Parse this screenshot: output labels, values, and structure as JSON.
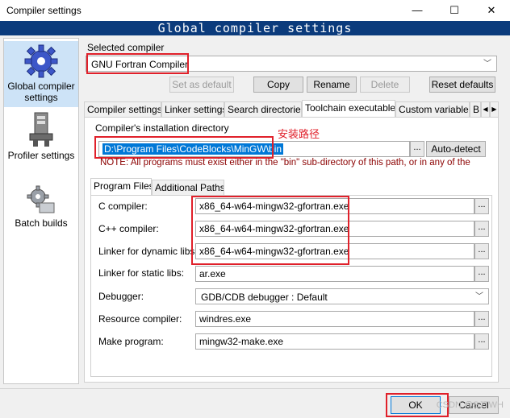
{
  "window": {
    "title": "Compiler settings",
    "min": "—",
    "max": "☐",
    "close": "✕"
  },
  "banner": "Global compiler settings",
  "sidebar": {
    "items": [
      {
        "label": "Global compiler settings",
        "icon": "gear-icon"
      },
      {
        "label": "Profiler settings",
        "icon": "profiler-icon"
      },
      {
        "label": "Batch builds",
        "icon": "batch-builds-icon"
      }
    ]
  },
  "compiler": {
    "section_label": "Selected compiler",
    "selected": "GNU Fortran Compiler",
    "buttons": {
      "set_default": "Set as default",
      "copy": "Copy",
      "rename": "Rename",
      "delete": "Delete",
      "reset": "Reset defaults"
    }
  },
  "tabs": [
    "Compiler settings",
    "Linker settings",
    "Search directories",
    "Toolchain executables",
    "Custom variables",
    "B"
  ],
  "tab_scroll": {
    "left": "◀",
    "right": "▶"
  },
  "install_dir": {
    "label": "Compiler's installation directory",
    "value": "D:\\Program Files\\CodeBlocks\\MinGW\\bin",
    "browse": "...",
    "auto_detect": "Auto-detect",
    "annotation": "安装路径",
    "note": "NOTE: All programs must exist either in the \"bin\" sub-directory of this path, or in any of the"
  },
  "subtabs": [
    "Program Files",
    "Additional Paths"
  ],
  "programs": [
    {
      "label": "C compiler:",
      "value": "x86_64-w64-mingw32-gfortran.exe"
    },
    {
      "label": "C++ compiler:",
      "value": "x86_64-w64-mingw32-gfortran.exe"
    },
    {
      "label": "Linker for dynamic libs:",
      "value": "x86_64-w64-mingw32-gfortran.exe"
    },
    {
      "label": "Linker for static libs:",
      "value": "ar.exe"
    },
    {
      "label": "Debugger:",
      "value": "GDB/CDB debugger : Default"
    },
    {
      "label": "Resource compiler:",
      "value": "windres.exe"
    },
    {
      "label": "Make program:",
      "value": "mingw32-make.exe"
    }
  ],
  "dialog_buttons": {
    "ok": "OK",
    "cancel": "Cancel"
  },
  "watermark": "CSDN @SJTWH",
  "colors": {
    "banner": "#0b3b7c",
    "annotation": "#e0202a",
    "note": "#8b0000",
    "selection": "#0078d7"
  }
}
